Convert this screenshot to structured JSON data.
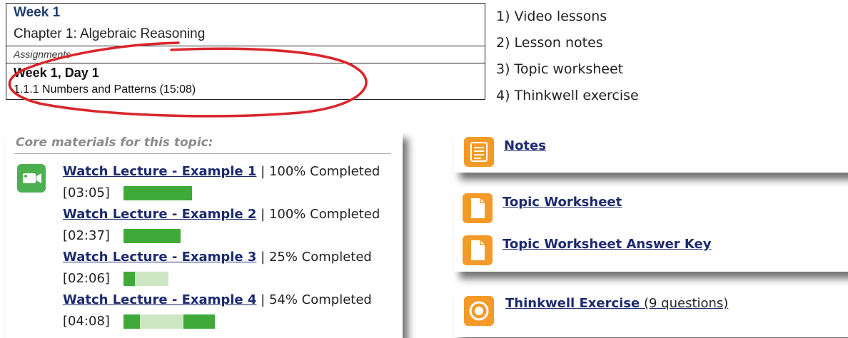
{
  "schedule": {
    "week": "Week 1",
    "chapter": "Chapter 1: Algebraic Reasoning",
    "assignments": "Assignments",
    "day": "Week 1, Day 1",
    "topic": "1.1.1 Numbers and Patterns  (15:08)"
  },
  "steps": [
    "1) Video lessons",
    "2) Lesson notes",
    "3) Topic worksheet",
    "4) Thinkwell exercise"
  ],
  "core": {
    "heading": "Core materials for this topic:",
    "icon": "video-camera-icon",
    "lectures": [
      {
        "title": "Watch Lecture - Example 1",
        "status": " | 100% Completed",
        "duration": "[03:05]",
        "progress": 1.0
      },
      {
        "title": "Watch Lecture - Example 2",
        "status": " | 100% Completed",
        "duration": "[02:37]",
        "progress": 1.0
      },
      {
        "title": "Watch Lecture - Example 3",
        "status": " | 25% Completed",
        "duration": "[02:06]",
        "progress": 0.25
      },
      {
        "title": "Watch Lecture - Example 4",
        "status": " | 54% Completed",
        "duration": "[04:08]",
        "progress": 0.54
      }
    ]
  },
  "notes": {
    "label": "Notes",
    "icon": "notes-icon"
  },
  "worksheet": {
    "items": [
      {
        "label": "Topic Worksheet",
        "icon": "document-icon"
      },
      {
        "label": "Topic Worksheet Answer Key",
        "icon": "document-icon"
      }
    ]
  },
  "exercise": {
    "label": "Thinkwell Exercise",
    "note": " (9 questions)",
    "icon": "target-icon"
  },
  "colors": {
    "link": "#1c2a6e",
    "progress_done": "#3faa3a",
    "progress_remaining": "#cde7c2",
    "video_icon": "#4caf50",
    "resource_icon": "#f49a28",
    "annotation": "#d9262c"
  }
}
